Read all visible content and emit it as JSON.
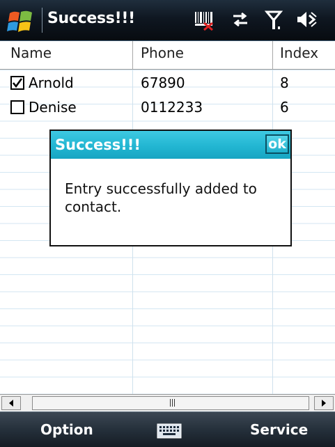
{
  "window": {
    "title": "Success!!!",
    "status_icons": [
      "barcode-connection-icon",
      "sync-arrows-icon",
      "signal-antenna-icon",
      "speaker-muted-icon"
    ]
  },
  "list": {
    "columns": [
      "Name",
      "Phone",
      "Index"
    ],
    "rows": [
      {
        "checked": true,
        "name": "Arnold",
        "phone": "67890",
        "index": "8"
      },
      {
        "checked": false,
        "name": "Denise",
        "phone": "0112233",
        "index": "6"
      }
    ]
  },
  "scrollbar": {
    "left_arrow": "◄",
    "right_arrow": "►"
  },
  "dialog": {
    "title": "Success!!!",
    "ok_label": "ok",
    "message": "Entry successfully added to contact."
  },
  "menubar": {
    "left_label": "Option",
    "right_label": "Service",
    "center_icon": "keyboard-icon"
  },
  "colors": {
    "dialog_title": "#22b6d2",
    "titlebar": "#0f1721",
    "grid_line": "#d3e6f2"
  }
}
